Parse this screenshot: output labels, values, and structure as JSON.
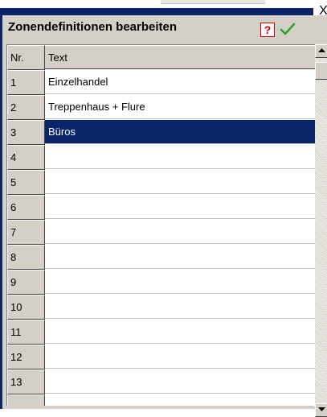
{
  "window": {
    "title": "Zonendefinitionen bearbeiten",
    "close_glyph": "X"
  },
  "toolbar": {
    "help_label": "?",
    "ok_icon": "checkmark-icon"
  },
  "grid": {
    "columns": [
      "Nr.",
      "Text"
    ],
    "rows": [
      {
        "nr": "1",
        "text": "Einzelhandel"
      },
      {
        "nr": "2",
        "text": "Treppenhaus + Flure"
      },
      {
        "nr": "3",
        "text": "Büros"
      },
      {
        "nr": "4",
        "text": ""
      },
      {
        "nr": "5",
        "text": ""
      },
      {
        "nr": "6",
        "text": ""
      },
      {
        "nr": "7",
        "text": ""
      },
      {
        "nr": "8",
        "text": ""
      },
      {
        "nr": "9",
        "text": ""
      },
      {
        "nr": "10",
        "text": ""
      },
      {
        "nr": "11",
        "text": ""
      },
      {
        "nr": "12",
        "text": ""
      },
      {
        "nr": "13",
        "text": ""
      },
      {
        "nr": "",
        "text": ""
      }
    ],
    "selected_row": 3
  },
  "colors": {
    "title_bar": "#0a246a",
    "selection": "#0a246a",
    "help": "#cc0000",
    "ok": "#2aa52a"
  }
}
